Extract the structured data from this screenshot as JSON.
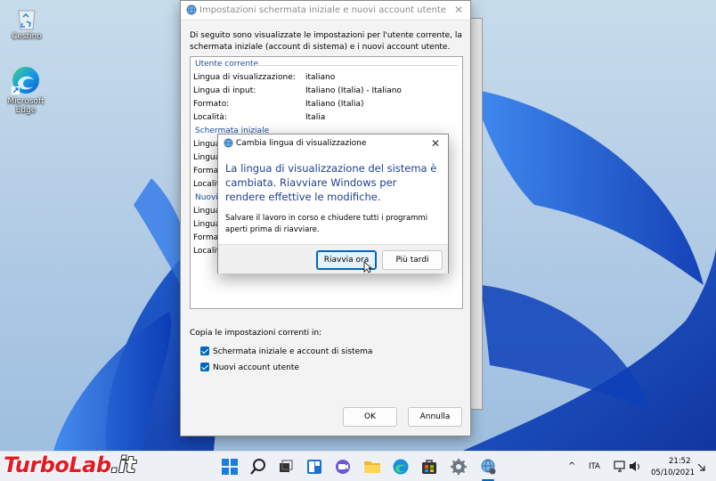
{
  "desktop": {
    "icons": [
      {
        "label": "Cestino",
        "icon": "recycle-bin-icon"
      },
      {
        "label": "Microsoft Edge",
        "icon": "edge-icon"
      }
    ]
  },
  "main_window": {
    "title": "Impostazioni schermata iniziale e nuovi account utente",
    "intro": "Di seguito sono visualizzate le impostazioni per l'utente corrente, la schermata iniziale (account di sistema) e i nuovi account utente.",
    "sections": [
      {
        "title": "Utente corrente",
        "rows": [
          {
            "label": "Lingua di visualizzazione:",
            "value": "italiano"
          },
          {
            "label": "Lingua di input:",
            "value": "Italiano (Italia) - Italiano"
          },
          {
            "label": "Formato:",
            "value": "Italiano (Italia)"
          },
          {
            "label": "Località:",
            "value": "Italia"
          }
        ]
      },
      {
        "title": "Schermata iniziale",
        "rows": [
          {
            "label": "Lingua"
          },
          {
            "label": "Lingua"
          },
          {
            "label": "Formato"
          },
          {
            "label": "Località"
          }
        ]
      },
      {
        "title": "Nuovi",
        "rows": [
          {
            "label": "Lingua"
          },
          {
            "label": "Lingua"
          },
          {
            "label": "Formato"
          },
          {
            "label": "Località"
          }
        ]
      }
    ],
    "copy_label": "Copia le impostazioni correnti in:",
    "checkboxes": [
      {
        "label": "Schermata iniziale e account di sistema",
        "checked": true
      },
      {
        "label": "Nuovi account utente",
        "checked": true
      }
    ],
    "ok_label": "OK",
    "cancel_label": "Annulla"
  },
  "dialog": {
    "title": "Cambia lingua di visualizzazione",
    "message": "La lingua di visualizzazione del sistema è cambiata. Riavviare Windows per rendere effettive le modifiche.",
    "sub": "Salvare il lavoro in corso e chiudere tutti i programmi aperti prima di riavviare.",
    "restart_label": "Riavvia ora",
    "later_label": "Più tardi"
  },
  "taskbar": {
    "apps": [
      "start-icon",
      "search-icon",
      "task-view-icon",
      "widgets-icon",
      "chat-icon",
      "file-explorer-icon",
      "edge-icon",
      "store-icon",
      "settings-icon",
      "language-settings-icon"
    ],
    "language": "ITA",
    "time": "21:52",
    "date": "05/10/2021"
  },
  "watermark": {
    "part1": "Turbo",
    "part2": "Lab",
    "part3": ".it",
    "colors": {
      "part1": "#e31b23",
      "part2": "#e31b23",
      "part3": "#ffffff"
    }
  },
  "colors": {
    "accent": "#0067c0",
    "heading_blue": "#1f4e9c",
    "message_blue": "#1e3f93"
  }
}
